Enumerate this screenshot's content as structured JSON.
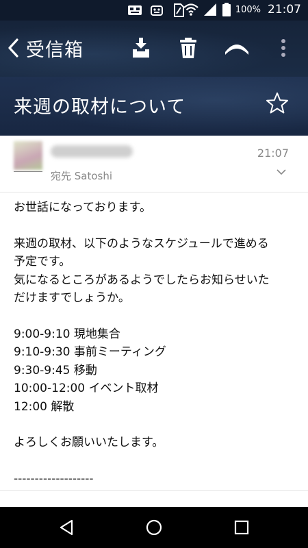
{
  "status_bar": {
    "battery_percent": "100%",
    "time": "21:07",
    "icons": [
      "notification-icon",
      "android-icon",
      "sim-icon",
      "wifi-icon",
      "signal-icon",
      "battery-icon"
    ]
  },
  "toolbar": {
    "back_label": "受信箱",
    "actions": [
      "archive-icon",
      "trash-icon",
      "reply-icon",
      "more-icon"
    ]
  },
  "subject": "来週の取材について",
  "sender": {
    "recipient": "宛先 Satoshi",
    "time": "21:07"
  },
  "body": {
    "greeting": "お世話になっております。",
    "intro_lines": [
      "来週の取材、以下のようなスケジュールで進める",
      "予定です。",
      "気になるところがあるようでしたらお知らせいた",
      "だけますでしょうか。"
    ],
    "schedule": [
      "9:00-9:10 現地集合",
      "9:10-9:30 事前ミーティング",
      "9:30-9:45 移動",
      "10:00-12:00 イベント取材",
      "12:00 解散"
    ],
    "closing": "よろしくお願いいたします。",
    "signature_divider": "-------------------"
  },
  "colors": {
    "header_bg": "#16243a",
    "subject_bg": "#1f3150",
    "text_dark": "#111111",
    "text_muted": "#888888",
    "nav_bg": "#000000"
  }
}
